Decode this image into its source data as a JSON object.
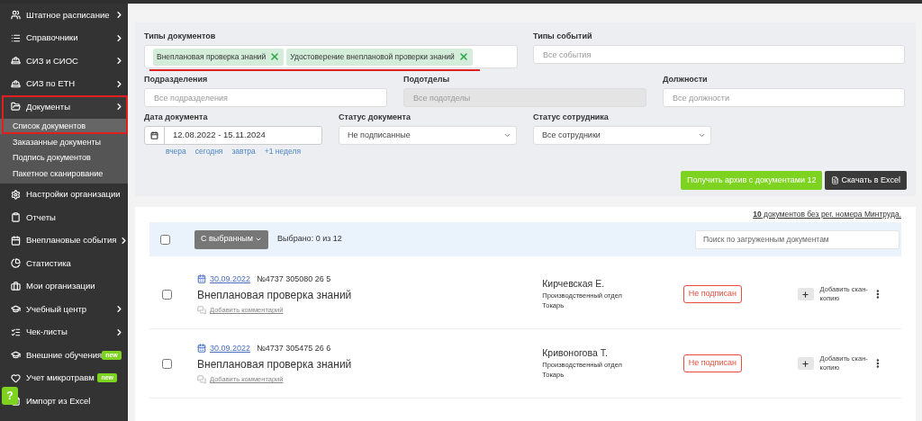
{
  "sidebar": {
    "items": [
      {
        "label": "Штатное расписание",
        "has_submenu": true
      },
      {
        "label": "Справочники",
        "has_submenu": true
      },
      {
        "label": "СИЗ и СИОС",
        "has_submenu": true
      },
      {
        "label": "СИЗ по ЕТН",
        "has_submenu": true
      },
      {
        "label": "Документы",
        "has_submenu": true,
        "children": [
          {
            "label": "Список документов",
            "selected": true
          },
          {
            "label": "Заказанные документы",
            "selected": false
          },
          {
            "label": "Подпись документов",
            "selected": false
          },
          {
            "label": "Пакетное сканирование",
            "selected": false
          }
        ]
      },
      {
        "label": "Настройки организации",
        "has_submenu": false
      },
      {
        "label": "Отчеты",
        "has_submenu": false
      },
      {
        "label": "Внеплановые события",
        "has_submenu": true
      },
      {
        "label": "Статистика",
        "has_submenu": false
      },
      {
        "label": "Мои организации",
        "has_submenu": false
      },
      {
        "label": "Учебный центр",
        "has_submenu": true
      },
      {
        "label": "Чек-листы",
        "has_submenu": true
      },
      {
        "label": "Внешние обучения",
        "has_submenu": false,
        "badge": "new"
      },
      {
        "label": "Учет микротравм",
        "has_submenu": false,
        "badge": "new"
      },
      {
        "label": "Импорт из Excel",
        "has_submenu": false
      }
    ]
  },
  "help_button": {
    "label": "?"
  },
  "filters": {
    "document_types": {
      "label": "Типы документов",
      "tags": [
        "Внеплановая проверка знаний",
        "Удостоверение внеплановой проверки знаний"
      ]
    },
    "event_types": {
      "label": "Типы событий",
      "placeholder": "Все события"
    },
    "departments": {
      "label": "Подразделения",
      "placeholder": "Все подразделения"
    },
    "subdepartments": {
      "label": "Подотделы",
      "placeholder": "Все подотделы",
      "disabled": true
    },
    "positions": {
      "label": "Должности",
      "placeholder": "Все должности"
    },
    "document_date": {
      "label": "Дата документа",
      "value": "12.08.2022 - 15.11.2024",
      "quick_links": [
        "вчера",
        "сегодня",
        "завтра",
        "+1 неделя"
      ]
    },
    "document_status": {
      "label": "Статус документа",
      "value": "Не подписанные"
    },
    "employee_status": {
      "label": "Статус сотрудника",
      "value": "Все сотрудники"
    },
    "buttons": [
      {
        "label": "Получить архив с документами 12",
        "kind": "primary"
      },
      {
        "label": "Скачать в Excel",
        "kind": "dark"
      }
    ]
  },
  "list": {
    "notice": "**10** документов без рег. номера Минтруда.",
    "toolbar": {
      "select_all_checked": false,
      "bulk_button": "С выбранным",
      "selected_count": "Выбрано: 0 из 12",
      "search_placeholder": "Поиск по загруженным документам"
    },
    "rows": [
      {
        "checked": false,
        "date": "30.09.2022",
        "number": "№4737 305080 26 5",
        "title": "Внеплановая проверка знаний",
        "comment_link": "Добавить комментарий",
        "employee": "Кирчевская Е.",
        "department": "Производственный отдел",
        "position": "Токарь",
        "status": "Не подписан",
        "add_scan": "Добавить скан-копию"
      },
      {
        "checked": false,
        "date": "30.09.2022",
        "number": "№4737 305475 26 6",
        "title": "Внеплановая проверка знаний",
        "comment_link": "Добавить комментарий",
        "employee": "Кривоногова Т.",
        "department": "Производственный отдел",
        "position": "Токарь",
        "status": "Не подписан",
        "add_scan": "Добавить скан-копию"
      }
    ]
  }
}
